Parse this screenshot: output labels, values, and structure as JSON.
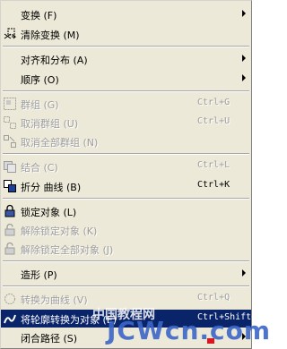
{
  "menu": {
    "items": [
      {
        "label": "变换 (F)",
        "shortcut": "",
        "submenu": true,
        "disabled": false,
        "icon": "none"
      },
      {
        "label": "清除变换 (M)",
        "shortcut": "",
        "submenu": false,
        "disabled": false,
        "icon": "clear-transform-icon"
      },
      {
        "label": "对齐和分布 (A)",
        "shortcut": "",
        "submenu": true,
        "disabled": false,
        "icon": "none"
      },
      {
        "label": "顺序 (O)",
        "shortcut": "",
        "submenu": true,
        "disabled": false,
        "icon": "none"
      },
      {
        "label": "群组 (G)",
        "shortcut": "Ctrl+G",
        "submenu": false,
        "disabled": true,
        "icon": "group-icon"
      },
      {
        "label": "取消群组 (U)",
        "shortcut": "Ctrl+U",
        "submenu": false,
        "disabled": true,
        "icon": "ungroup-icon"
      },
      {
        "label": "取消全部群组 (N)",
        "shortcut": "",
        "submenu": false,
        "disabled": true,
        "icon": "ungroup-all-icon"
      },
      {
        "label": "结合 (C)",
        "shortcut": "Ctrl+L",
        "submenu": false,
        "disabled": true,
        "icon": "combine-icon"
      },
      {
        "label": "折分 曲线 (B)",
        "shortcut": "Ctrl+K",
        "submenu": false,
        "disabled": false,
        "icon": "break-apart-icon"
      },
      {
        "label": "锁定对象 (L)",
        "shortcut": "",
        "submenu": false,
        "disabled": false,
        "icon": "lock-icon"
      },
      {
        "label": "解除锁定对象 (K)",
        "shortcut": "",
        "submenu": false,
        "disabled": true,
        "icon": "unlock-icon"
      },
      {
        "label": "解除锁定全部对象 (J)",
        "shortcut": "",
        "submenu": false,
        "disabled": true,
        "icon": "unlock-all-icon"
      },
      {
        "label": "造形 (P)",
        "shortcut": "",
        "submenu": true,
        "disabled": false,
        "icon": "none"
      },
      {
        "label": "转换为曲线 (V)",
        "shortcut": "Ctrl+Q",
        "submenu": false,
        "disabled": true,
        "icon": "convert-to-curves-icon"
      },
      {
        "label": "将轮廓转换为对象 (E)",
        "shortcut": "Ctrl+Shift+Q",
        "submenu": false,
        "disabled": false,
        "highlighted": true,
        "icon": "outline-to-object-icon"
      },
      {
        "label": "闭合路径 (S)",
        "shortcut": "",
        "submenu": true,
        "disabled": false,
        "icon": "none"
      }
    ]
  },
  "watermark": {
    "line1": "中国教程网",
    "line2": "JCWcn.com"
  },
  "colors": {
    "menu_bg": "#ece9d8",
    "highlight": "#0a246a",
    "disabled_text": "#9d9d9d"
  }
}
